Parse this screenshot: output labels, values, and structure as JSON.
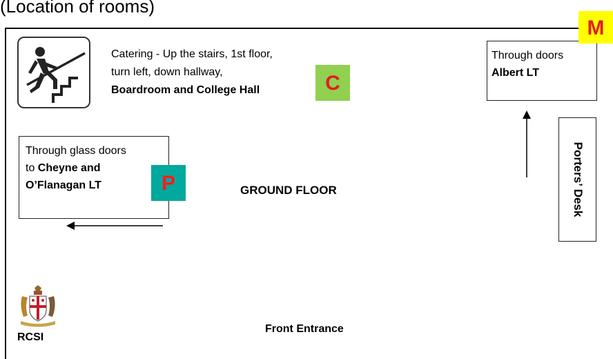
{
  "title": "(Location of rooms)",
  "catering": {
    "line1": "Catering - Up the stairs, 1st floor,",
    "line2": "turn left, down hallway,",
    "line3": "Boardroom and College Hall"
  },
  "badges": {
    "catering": {
      "letter": "C",
      "bg": "#92d050",
      "fg": "#e01f1f"
    },
    "pathology": {
      "letter": "P",
      "bg": "#00a89d",
      "fg": "#ff1a1a"
    },
    "main": {
      "letter": "M",
      "bg": "#ffff00",
      "fg": "#e01f1f"
    }
  },
  "albert": {
    "line1": "Through doors",
    "line2": "Albert LT"
  },
  "cheyne": {
    "line1": "Through glass doors",
    "line2_prefix": "to ",
    "line2_bold": "Cheyne and",
    "line3": "O’Flanagan LT"
  },
  "porters_desk": "Porters’ Desk",
  "ground_floor": "GROUND FLOOR",
  "front_entrance": "Front Entrance",
  "logo": {
    "text": "RCSI"
  }
}
